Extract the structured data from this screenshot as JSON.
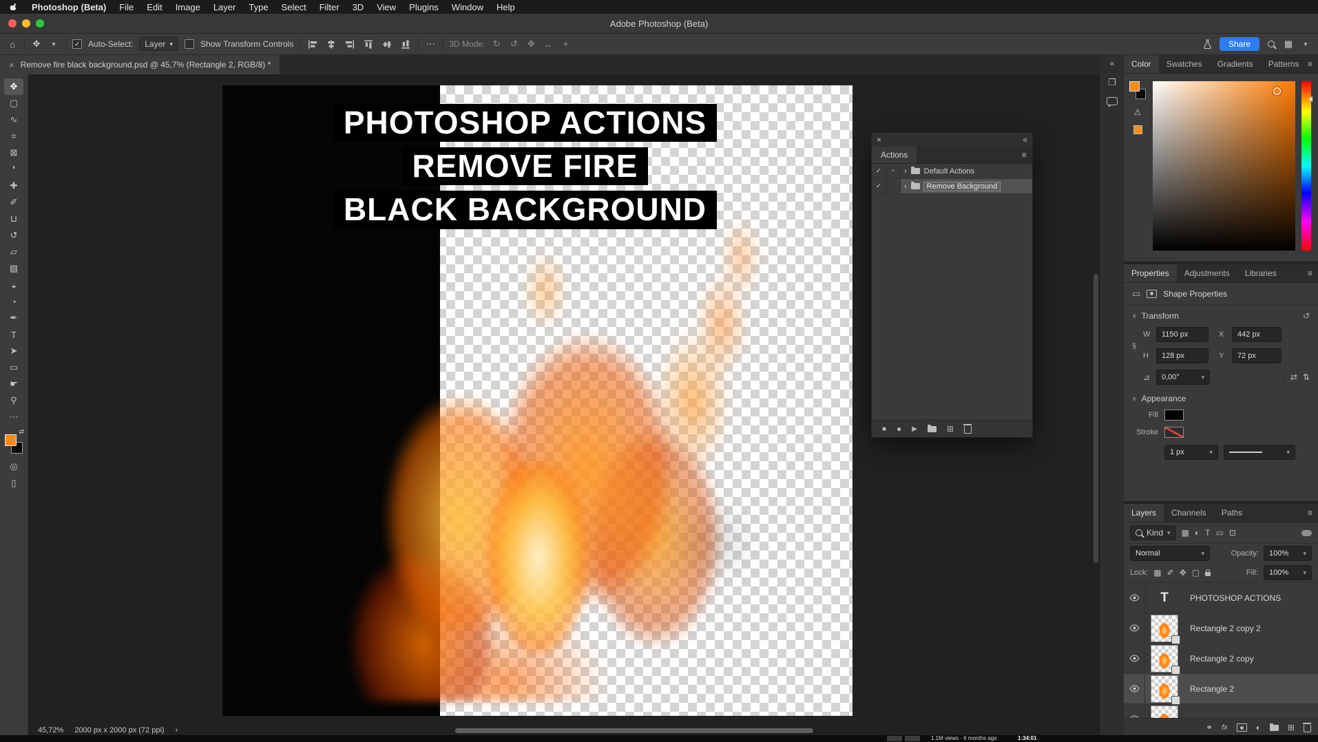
{
  "menubar": {
    "app_name": "Photoshop (Beta)",
    "items": [
      "File",
      "Edit",
      "Image",
      "Layer",
      "Type",
      "Select",
      "Filter",
      "3D",
      "View",
      "Plugins",
      "Window",
      "Help"
    ]
  },
  "titlebar": {
    "title": "Adobe Photoshop (Beta)"
  },
  "options_bar": {
    "auto_select_label": "Auto-Select:",
    "auto_select_value": "Layer",
    "show_transform_label": "Show Transform Controls",
    "mode_label": "3D Mode:",
    "share_label": "Share"
  },
  "document_tab": {
    "title": "Remove fire black background.psd @ 45,7% (Rectangle 2, RGB/8) *"
  },
  "tools": [
    {
      "name": "move-tool",
      "glyph": "✥"
    },
    {
      "name": "marquee-tool",
      "glyph": "▢"
    },
    {
      "name": "lasso-tool",
      "glyph": "∿"
    },
    {
      "name": "crop-tool",
      "glyph": "⌗"
    },
    {
      "name": "frame-tool",
      "glyph": "⊠"
    },
    {
      "name": "eyedropper-tool",
      "glyph": "❛"
    },
    {
      "name": "healing-brush-tool",
      "glyph": "✚"
    },
    {
      "name": "brush-tool",
      "glyph": "✐"
    },
    {
      "name": "clone-stamp-tool",
      "glyph": "⊔"
    },
    {
      "name": "history-brush-tool",
      "glyph": "↺"
    },
    {
      "name": "eraser-tool",
      "glyph": "▱"
    },
    {
      "name": "gradient-tool",
      "glyph": "▧"
    },
    {
      "name": "blur-tool",
      "glyph": "◒"
    },
    {
      "name": "dodge-tool",
      "glyph": "◔"
    },
    {
      "name": "pen-tool",
      "glyph": "✒"
    },
    {
      "name": "type-tool",
      "glyph": "T"
    },
    {
      "name": "path-selection-tool",
      "glyph": "➤"
    },
    {
      "name": "shape-tool",
      "glyph": "▭"
    },
    {
      "name": "hand-tool",
      "glyph": "☛"
    },
    {
      "name": "zoom-tool",
      "glyph": "⚲"
    },
    {
      "name": "edit-toolbar",
      "glyph": "⋯"
    },
    {
      "name": "quick-mask",
      "glyph": "◎"
    },
    {
      "name": "screen-mode",
      "glyph": "▯"
    }
  ],
  "canvas": {
    "heading_lines": [
      "PHOTOSHOP ACTIONS",
      "REMOVE FIRE",
      "BLACK BACKGROUND"
    ]
  },
  "status_bar": {
    "zoom": "45,72%",
    "doc_info": "2000 px x 2000 px (72 ppi)"
  },
  "actions_panel": {
    "title": "Actions",
    "rows": [
      {
        "label": "Default Actions"
      },
      {
        "label": "Remove Background"
      }
    ]
  },
  "color_panel": {
    "tabs": [
      "Color",
      "Swatches",
      "Gradients",
      "Patterns"
    ]
  },
  "properties_panel": {
    "tabs": [
      "Properties",
      "Adjustments",
      "Libraries"
    ],
    "header": "Shape Properties",
    "transform_title": "Transform",
    "w_label": "W",
    "w_value": "1150 px",
    "x_label": "X",
    "x_value": "442 px",
    "h_label": "H",
    "h_value": "128 px",
    "y_label": "Y",
    "y_value": "72 px",
    "angle_value": "0,00°",
    "appearance_title": "Appearance",
    "fill_label": "Fill",
    "stroke_label": "Stroke",
    "stroke_width_value": "1 px"
  },
  "layers_panel": {
    "tabs": [
      "Layers",
      "Channels",
      "Paths"
    ],
    "filter_value": "Kind",
    "blend_mode": "Normal",
    "opacity_label": "Opacity:",
    "opacity_value": "100%",
    "lock_label": "Lock:",
    "fill_label": "Fill:",
    "fill_value": "100%",
    "layers": [
      {
        "name": "PHOTOSHOP ACTIONS"
      },
      {
        "name": "Rectangle 2 copy 2"
      },
      {
        "name": "Rectangle 2 copy"
      },
      {
        "name": "Rectangle 2"
      }
    ]
  },
  "video_overlay": {
    "caption": "1.1M views · 6 months ago",
    "timestamp": "1:34:01"
  },
  "colors": {
    "accent_blue": "#2e7cf0",
    "foreground_orange": "#ff8a16",
    "selected_row_gray": "#4d4d4d"
  },
  "icons": {
    "home": "⌂",
    "menu": "≡",
    "close": "×",
    "collapse_left": "«",
    "chevron_down": "▾",
    "expand": "›",
    "ellipsis": "⋯",
    "check": "✓",
    "stop": "■",
    "record": "●",
    "play": "▶",
    "new_item": "⊞",
    "link": "⚭",
    "adjustment": "◐",
    "grid": "▦",
    "smart_object": "⊡",
    "shape": "▭",
    "type": "T",
    "angle": "⊿",
    "flip_h": "⇄",
    "flip_v": "⇅",
    "reset": "↺",
    "warning": "⚠",
    "swap": "⇄",
    "panel_square": "❐",
    "fx": "fx",
    "checker": "▦",
    "brush": "✐",
    "move": "✥",
    "artboard": "▢",
    "dialog": "▫",
    "mode": [
      "↻",
      "↺",
      "✥",
      "↔",
      "⌖"
    ]
  }
}
